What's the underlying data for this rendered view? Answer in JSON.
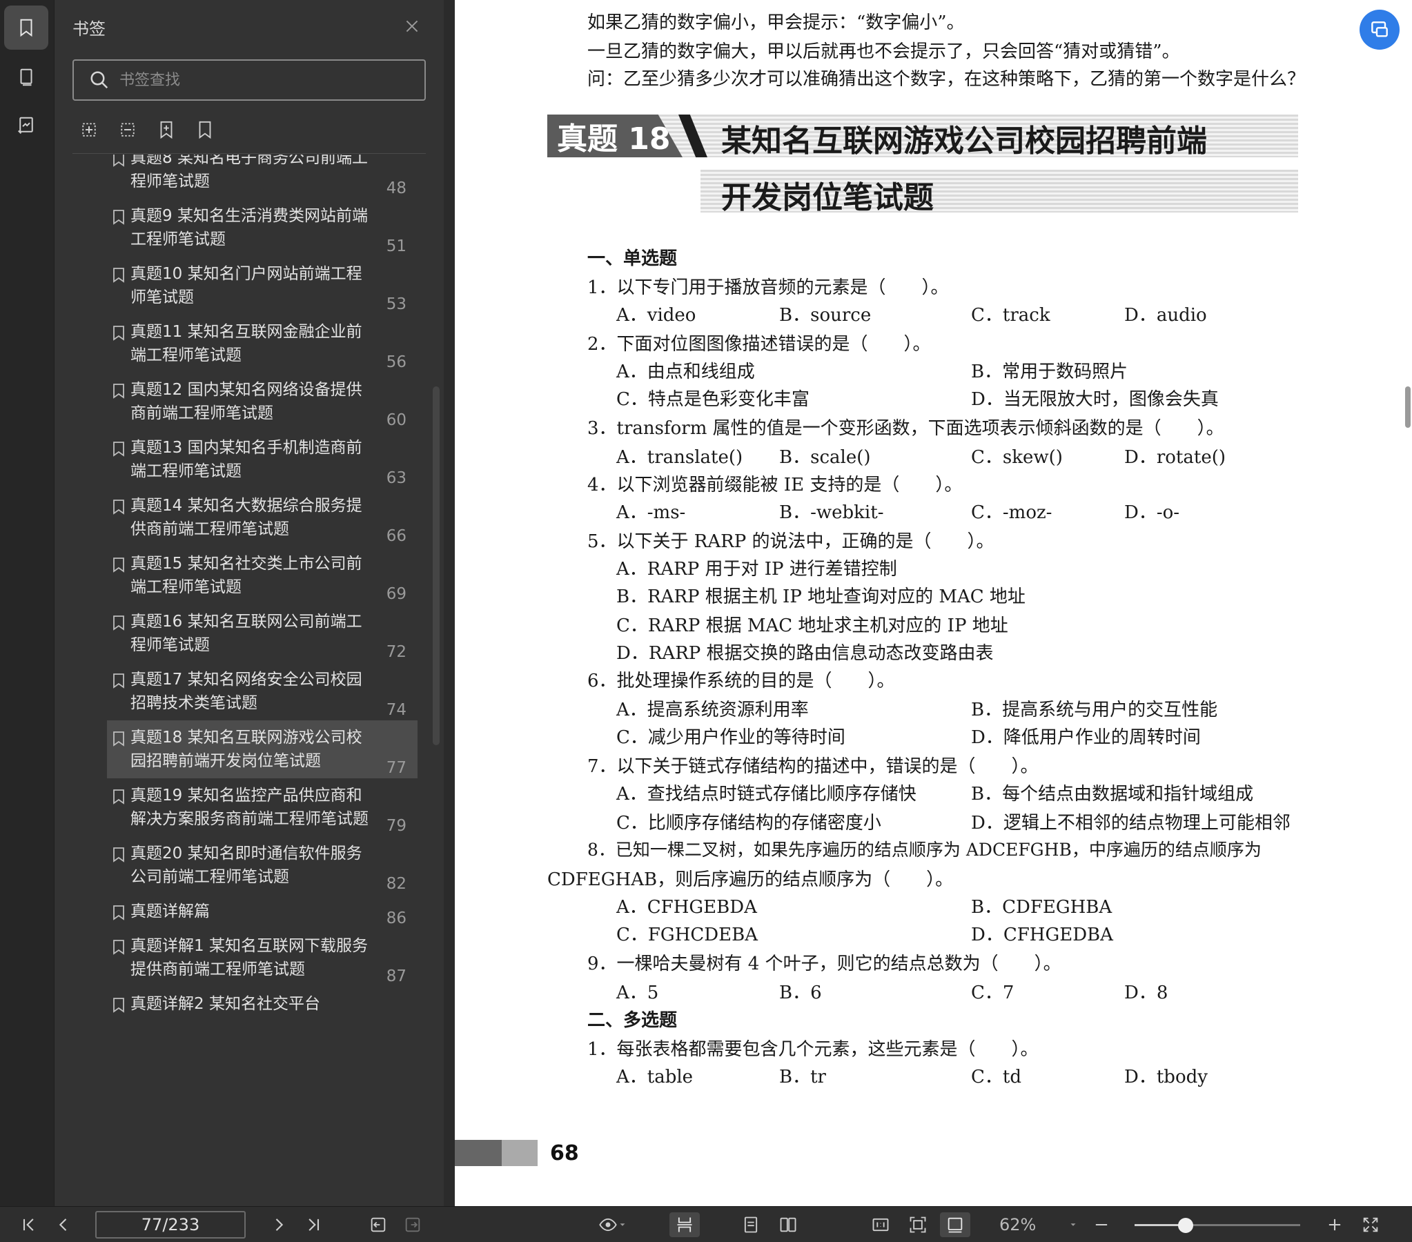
{
  "panel": {
    "title": "书签",
    "search_placeholder": "书签查找",
    "bookmarks": [
      {
        "title": "真题8 某知名电子商务公司前端工程师笔试题",
        "page": "48"
      },
      {
        "title": "真题9 某知名生活消费类网站前端工程师笔试题",
        "page": "51"
      },
      {
        "title": "真题10 某知名门户网站前端工程师笔试题",
        "page": "53"
      },
      {
        "title": "真题11 某知名互联网金融企业前端工程师笔试题",
        "page": "56"
      },
      {
        "title": "真题12 国内某知名网络设备提供商前端工程师笔试题",
        "page": "60"
      },
      {
        "title": "真题13 国内某知名手机制造商前端工程师笔试题",
        "page": "63"
      },
      {
        "title": "真题14 某知名大数据综合服务提供商前端工程师笔试题",
        "page": "66"
      },
      {
        "title": "真题15 某知名社交类上市公司前端工程师笔试题",
        "page": "69"
      },
      {
        "title": "真题16 某知名互联网公司前端工程师笔试题",
        "page": "72"
      },
      {
        "title": "真题17 某知名网络安全公司校园招聘技术类笔试题",
        "page": "74"
      },
      {
        "title": "真题18 某知名互联网游戏公司校园招聘前端开发岗位笔试题",
        "page": "77"
      },
      {
        "title": "真题19 某知名监控产品供应商和解决方案服务商前端工程师笔试题",
        "page": "79"
      },
      {
        "title": "真题20 某知名即时通信软件服务公司前端工程师笔试题",
        "page": "82"
      },
      {
        "title": "真题详解篇",
        "page": "86"
      },
      {
        "title": "真题详解1 某知名互联网下载服务提供商前端工程师笔试题",
        "page": "87"
      },
      {
        "title": "真题详解2 某知名社交平台",
        "page": ""
      }
    ]
  },
  "doc": {
    "intro": [
      "如果乙猜的数字偏小，甲会提示：“数字偏小”。",
      "一旦乙猜的数字偏大，甲以后就再也不会提示了，只会回答“猜对或猜错”。",
      "问：乙至少猜多少次才可以准确猜出这个数字，在这种策略下，乙猜的第一个数字是什么？"
    ],
    "tag": "真题 18",
    "title_line1": "某知名互联网游戏公司校园招聘前端",
    "title_line2": "开发岗位笔试题",
    "section1": "一、单选题",
    "q1": "1．以下专门用于播放音频的元素是（　　）。",
    "q1_opts": [
      "A．video",
      "B．source",
      "C．track",
      "D．audio"
    ],
    "q2": "2．下面对位图图像描述错误的是（　　）。",
    "q2_opts": [
      "A．由点和线组成",
      "B．常用于数码照片",
      "C．特点是色彩变化丰富",
      "D．当无限放大时，图像会失真"
    ],
    "q3": "3．transform 属性的值是一个变形函数，下面选项表示倾斜函数的是（　　）。",
    "q3_opts": [
      "A．translate()",
      "B．scale()",
      "C．skew()",
      "D．rotate()"
    ],
    "q4": "4．以下浏览器前缀能被 IE 支持的是（　　）。",
    "q4_opts": [
      "A．-ms-",
      "B．-webkit-",
      "C．-moz-",
      "D．-o-"
    ],
    "q5": "5．以下关于 RARP 的说法中，正确的是（　　）。",
    "q5_opts": [
      "A．RARP 用于对 IP 进行差错控制",
      "B．RARP 根据主机 IP 地址查询对应的 MAC 地址",
      "C．RARP 根据 MAC 地址求主机对应的 IP 地址",
      "D．RARP 根据交换的路由信息动态改变路由表"
    ],
    "q6": "6．批处理操作系统的目的是（　　）。",
    "q6_opts": [
      "A．提高系统资源利用率",
      "B．提高系统与用户的交互性能",
      "C．减少用户作业的等待时间",
      "D．降低用户作业的周转时间"
    ],
    "q7": "7．以下关于链式存储结构的描述中，错误的是（　　）。",
    "q7_opts": [
      "A．查找结点时链式存储比顺序存储快",
      "B．每个结点由数据域和指针域组成",
      "C．比顺序存储结构的存储密度小",
      "D．逻辑上不相邻的结点物理上可能相邻"
    ],
    "q8_line1": "8．已知一棵二叉树，如果先序遍历的结点顺序为 ADCEFGHB，中序遍历的结点顺序为",
    "q8_line2": "CDFEGHAB，则后序遍历的结点顺序为（　　）。",
    "q8_opts": [
      "A．CFHGEBDA",
      "B．CDFEGHBA",
      "C．FGHCDEBA",
      "D．CFHGEDBA"
    ],
    "q9": "9．一棵哈夫曼树有 4 个叶子，则它的结点总数为（　　）。",
    "q9_opts": [
      "A．5",
      "B．6",
      "C．7",
      "D．8"
    ],
    "section2": "二、多选题",
    "m1": "1．每张表格都需要包含几个元素，这些元素是（　　）。",
    "m1_opts": [
      "A．table",
      "B．tr",
      "C．td",
      "D．tbody"
    ],
    "page_number": "68"
  },
  "toolbar": {
    "page_indicator": "77/233",
    "zoom": "62%",
    "zoom_level": 0.31
  },
  "colors": {
    "accent": "#2f7de8",
    "panel_bg": "#333333",
    "selected_bg": "#4c4c4c"
  }
}
